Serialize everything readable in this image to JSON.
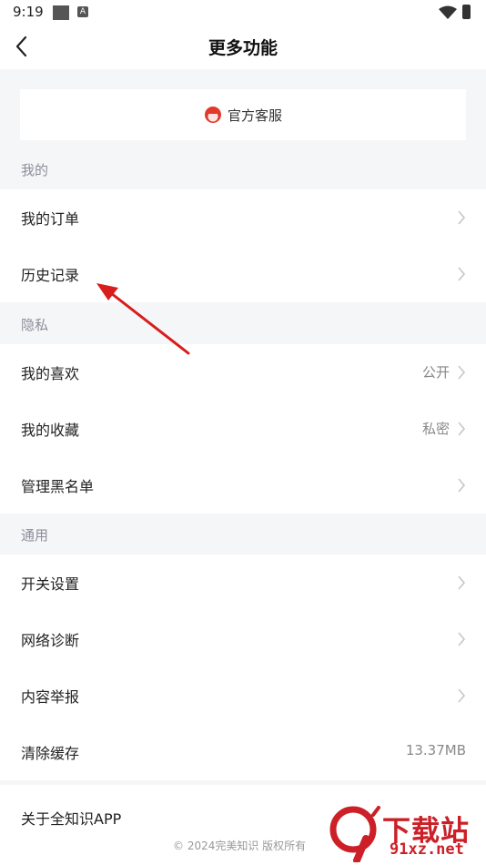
{
  "status_bar": {
    "time": "9:19",
    "a_icon_label": "A"
  },
  "header": {
    "title": "更多功能"
  },
  "service": {
    "label": "官方客服"
  },
  "sections": {
    "mine": {
      "title": "我的",
      "items": [
        {
          "label": "我的订单",
          "value": ""
        },
        {
          "label": "历史记录",
          "value": ""
        }
      ]
    },
    "privacy": {
      "title": "隐私",
      "items": [
        {
          "label": "我的喜欢",
          "value": "公开"
        },
        {
          "label": "我的收藏",
          "value": "私密"
        },
        {
          "label": "管理黑名单",
          "value": ""
        }
      ]
    },
    "general": {
      "title": "通用",
      "items": [
        {
          "label": "开关设置",
          "value": ""
        },
        {
          "label": "网络诊断",
          "value": ""
        },
        {
          "label": "内容举报",
          "value": ""
        },
        {
          "label": "清除缓存",
          "value": "13.37MB"
        }
      ]
    }
  },
  "about": {
    "label": "关于全知识APP",
    "copyright": "© 2024完美知识 版权所有"
  },
  "watermark": {
    "line1": "下载站",
    "line2": "91xz.net",
    "logo_text": "9"
  },
  "colors": {
    "accent": "#e23a2a",
    "annotation_arrow": "#d91c1c",
    "background": "#f5f6f8"
  }
}
